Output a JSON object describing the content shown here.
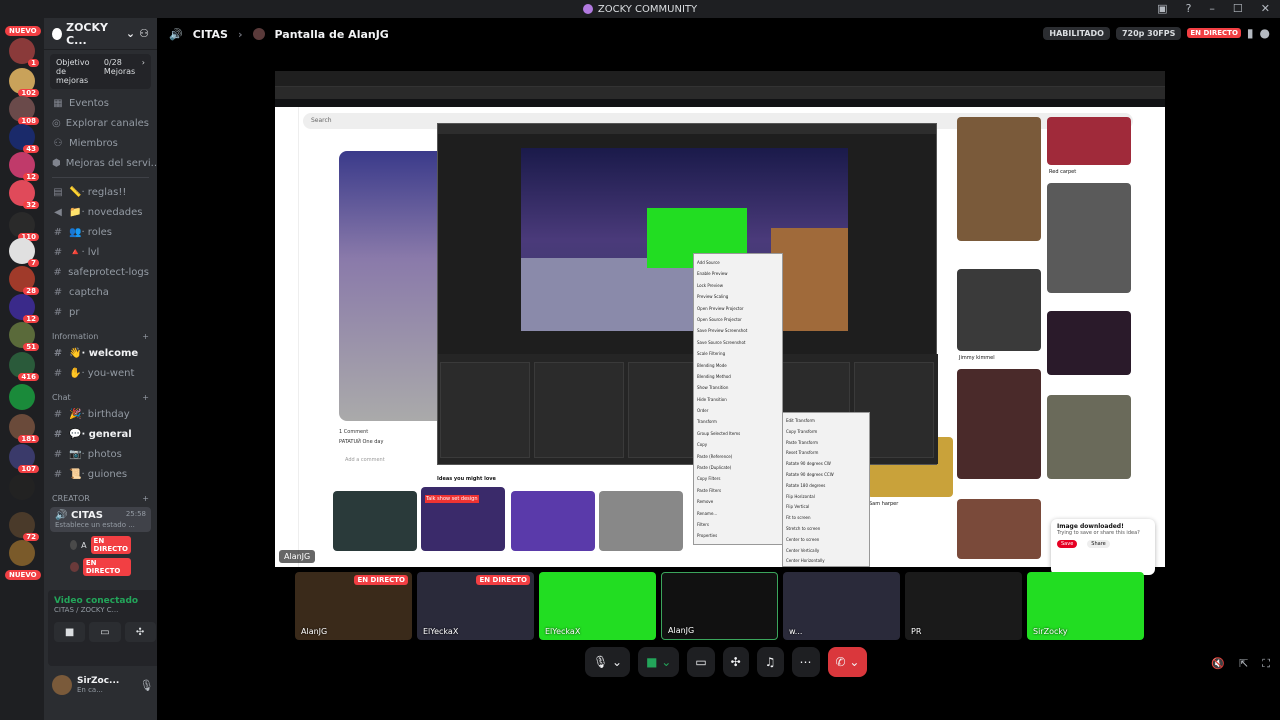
{
  "window": {
    "title": "ZOCKY COMMUNITY"
  },
  "server_badges": {
    "nuevo_top": "NUEVO",
    "b1": "1",
    "b2": "102",
    "b3": "108",
    "b4": "43",
    "b5": "12",
    "b6": "32",
    "b7": "110",
    "b8": "7",
    "b9": "28",
    "b10": "12",
    "b11": "51",
    "b12": "416",
    "b13": "181",
    "b14": "107",
    "b15": "72",
    "nuevo_bottom": "NUEVO"
  },
  "guild": {
    "name": "ZOCKY C...",
    "goal_label": "Objetivo de mejoras",
    "goal_value": "0/28 Mejoras"
  },
  "nav": [
    {
      "icon": "▦",
      "label": "Eventos"
    },
    {
      "icon": "◎",
      "label": "Explorar canales"
    },
    {
      "icon": "⚇",
      "label": "Miembros"
    },
    {
      "icon": "⬢",
      "label": "Mejoras del servi..."
    }
  ],
  "channels_top": [
    {
      "icon": "▤",
      "label": "📏· reglas!!",
      "bold": false
    },
    {
      "icon": "◀",
      "label": "📁· novedades",
      "bold": false
    },
    {
      "icon": "#",
      "label": "👥· roles",
      "bold": false
    },
    {
      "icon": "#",
      "label": "🔺· lvl",
      "bold": false
    },
    {
      "icon": "#",
      "label": "safeprotect-logs",
      "bold": false
    },
    {
      "icon": "#",
      "label": "captcha",
      "bold": false
    },
    {
      "icon": "#",
      "label": "pr",
      "bold": false
    }
  ],
  "category_info": "Information",
  "channels_info": [
    {
      "icon": "#",
      "label": "👋· welcome",
      "bold": true
    },
    {
      "icon": "#",
      "label": "✋· you-went",
      "bold": false
    }
  ],
  "category_chat": "Chat",
  "channels_chat": [
    {
      "icon": "#",
      "label": "🎉· birthday",
      "bold": false
    },
    {
      "icon": "#",
      "label": "💬· general",
      "bold": true
    },
    {
      "icon": "#",
      "label": "📷· photos",
      "bold": false
    },
    {
      "icon": "#",
      "label": "📜· guiones",
      "bold": false
    }
  ],
  "category_creator": "CREATOR",
  "voice": {
    "name": "CITAS",
    "timer": "25:58",
    "sub": "Establece un estado ...",
    "user1": "A",
    "user1_status": "EN DIRECTO",
    "user2_status": "EN DIRECTO"
  },
  "voice_panel": {
    "status": "Video conectado",
    "sub": "CITAS / ZOCKY C..."
  },
  "user": {
    "name": "SirZoc...",
    "status": "En ca..."
  },
  "stage": {
    "channel": "CITAS",
    "screen": "Pantalla de AlanJG",
    "badge_enabled": "HABILITADO",
    "quality": "720p 30FPS",
    "live": "EN DIRECTO"
  },
  "shared_screen": {
    "label": "AlanJG",
    "search": "Search",
    "comments": "1 Comment",
    "commenter": "PATATUЙ One day",
    "add_comment": "Add a comment",
    "ideas": "Ideas you might love",
    "talkshow": "Talk show set design",
    "toast_title": "Image downloaded!",
    "toast_sub": "Trying to save or share this idea?",
    "toast_save": "Save",
    "toast_share": "Share",
    "red_carpet": "Red carpet",
    "jimmy": "Jimmy kimmel",
    "sam": "Sam harper"
  },
  "obs_context": [
    "Add Source",
    "Enable Preview",
    "Lock Preview",
    "Preview Scaling",
    "Open Preview Projector",
    "Open Source Projector",
    "Save Preview Screenshot",
    "Save Source Screenshot",
    "Scale Filtering",
    "Blending Mode",
    "Blending Method",
    "Show Transition",
    "Hide Transition",
    "Order",
    "Transform",
    "Group Selected Items",
    "Copy",
    "Paste (Reference)",
    "Paste (Duplicate)",
    "Copy Filters",
    "Paste Filters",
    "Remove",
    "Rename...",
    "Filters",
    "Properties"
  ],
  "obs_transform": [
    "Edit Transform",
    "Copy Transform",
    "Paste Transform",
    "Reset Transform",
    "Rotate 90 degrees CW",
    "Rotate 90 degrees CCW",
    "Rotate 180 degrees",
    "Flip Horizontal",
    "Flip Vertical",
    "Fit to screen",
    "Stretch to screen",
    "Center to screen",
    "Center Vertically",
    "Center Horizontally"
  ],
  "tiles": [
    {
      "name": "AlanJG",
      "live": "EN DIRECTO"
    },
    {
      "name": "ElYeckaX",
      "live": "EN DIRECTO"
    },
    {
      "name": "ElYeckaX",
      "live": ""
    },
    {
      "name": "AlanJG",
      "live": ""
    },
    {
      "name": "w...",
      "live": ""
    },
    {
      "name": "PR",
      "live": ""
    },
    {
      "name": "SirZocky",
      "live": ""
    }
  ]
}
